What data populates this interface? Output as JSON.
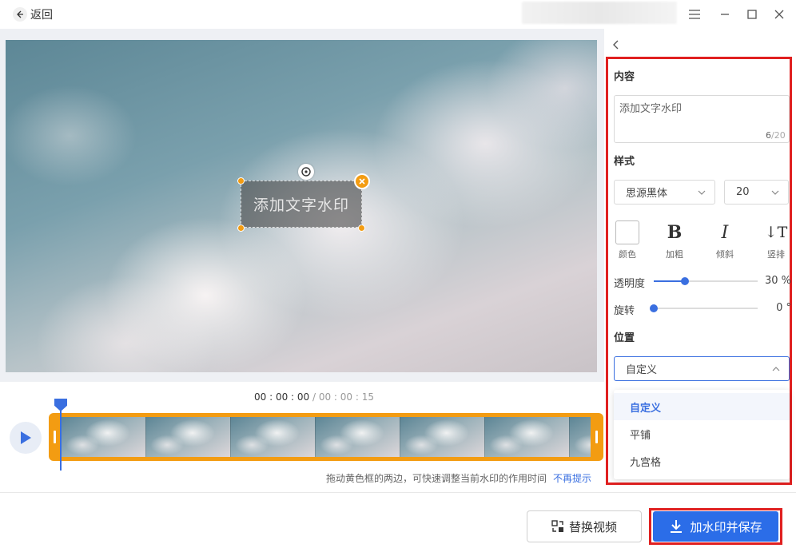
{
  "titlebar": {
    "back_label": "返回",
    "icons": [
      "arrow-left-icon",
      "menu-icon",
      "minimize-icon",
      "maximize-icon",
      "close-icon"
    ]
  },
  "preview": {
    "watermark_text": "添加文字水印"
  },
  "timeline": {
    "current_time": "00 : 00 : 00",
    "separator": " / ",
    "total_time": "00 : 00 : 15",
    "hint": "拖动黄色框的两边，可快速调整当前水印的作用时间",
    "hint_link": "不再提示"
  },
  "panel": {
    "content_title": "内容",
    "content_value": "添加文字水印",
    "char_count": "6",
    "char_separator": "/",
    "char_max": "20",
    "style_title": "样式",
    "font_family": "思源黑体",
    "font_size": "20",
    "style_buttons": {
      "color": "颜色",
      "bold": "加粗",
      "italic": "倾斜",
      "vertical": "竖排"
    },
    "opacity_label": "透明度",
    "opacity_value": "30",
    "opacity_unit": "%",
    "opacity_fraction": 0.3,
    "rotation_label": "旋转",
    "rotation_value": "0",
    "rotation_unit": "°",
    "rotation_fraction": 0,
    "position_title": "位置",
    "position_selected": "自定义",
    "position_options": [
      "自定义",
      "平铺",
      "九宫格"
    ]
  },
  "footer": {
    "replace_label": "替换视频",
    "save_label": "加水印并保存"
  },
  "colors": {
    "accent": "#3a6fe0",
    "save_button": "#2b6de8",
    "track": "#f39c12",
    "highlight": "#e02020"
  }
}
